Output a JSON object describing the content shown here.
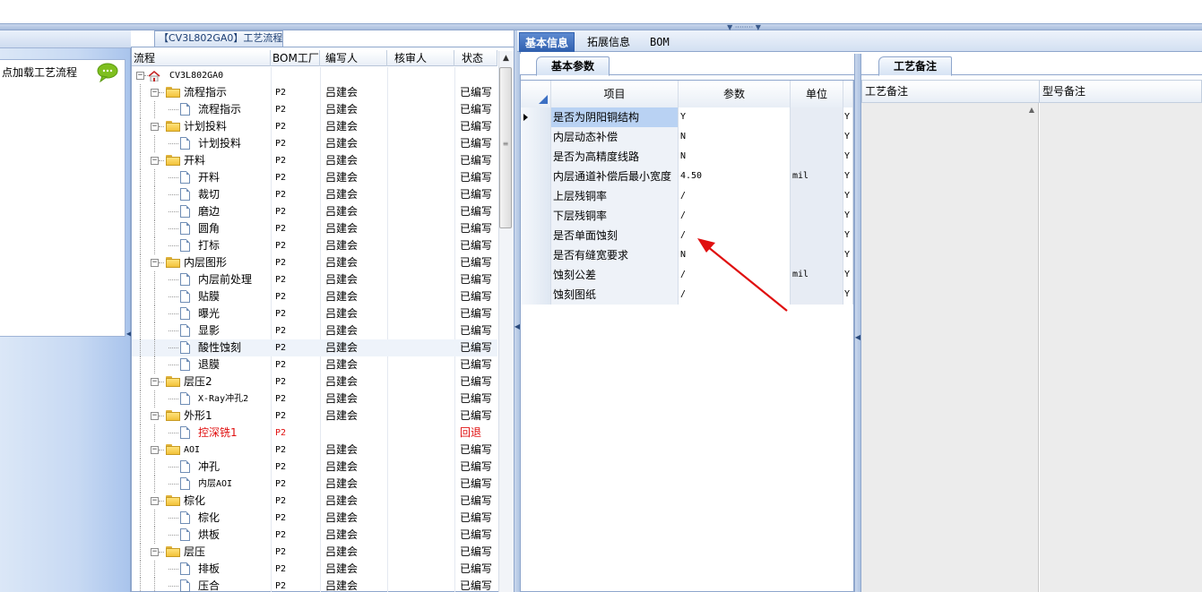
{
  "left": {
    "load_process_text": "点加载工艺流程"
  },
  "center": {
    "caption": "【CV3L802GA0】工艺流程",
    "columns": [
      "流程",
      "BOM工厂",
      "编写人",
      "核审人",
      "状态"
    ],
    "root": "CV3L802GA0",
    "rows": [
      {
        "name": "流程指示",
        "bom": "P2",
        "writer": "吕建会",
        "status": "已编写",
        "level": 1,
        "folder": true
      },
      {
        "name": "流程指示",
        "bom": "P2",
        "writer": "吕建会",
        "status": "已编写",
        "level": 2
      },
      {
        "name": "计划投料",
        "bom": "P2",
        "writer": "吕建会",
        "status": "已编写",
        "level": 1,
        "folder": true
      },
      {
        "name": "计划投料",
        "bom": "P2",
        "writer": "吕建会",
        "status": "已编写",
        "level": 2
      },
      {
        "name": "开料",
        "bom": "P2",
        "writer": "吕建会",
        "status": "已编写",
        "level": 1,
        "folder": true
      },
      {
        "name": "开料",
        "bom": "P2",
        "writer": "吕建会",
        "status": "已编写",
        "level": 2
      },
      {
        "name": "裁切",
        "bom": "P2",
        "writer": "吕建会",
        "status": "已编写",
        "level": 2
      },
      {
        "name": "磨边",
        "bom": "P2",
        "writer": "吕建会",
        "status": "已编写",
        "level": 2
      },
      {
        "name": "圆角",
        "bom": "P2",
        "writer": "吕建会",
        "status": "已编写",
        "level": 2
      },
      {
        "name": "打标",
        "bom": "P2",
        "writer": "吕建会",
        "status": "已编写",
        "level": 2
      },
      {
        "name": "内层图形",
        "bom": "P2",
        "writer": "吕建会",
        "status": "已编写",
        "level": 1,
        "folder": true
      },
      {
        "name": "内层前处理",
        "bom": "P2",
        "writer": "吕建会",
        "status": "已编写",
        "level": 2
      },
      {
        "name": "贴膜",
        "bom": "P2",
        "writer": "吕建会",
        "status": "已编写",
        "level": 2
      },
      {
        "name": "曝光",
        "bom": "P2",
        "writer": "吕建会",
        "status": "已编写",
        "level": 2
      },
      {
        "name": "显影",
        "bom": "P2",
        "writer": "吕建会",
        "status": "已编写",
        "level": 2
      },
      {
        "name": "酸性蚀刻",
        "bom": "P2",
        "writer": "吕建会",
        "status": "已编写",
        "level": 2,
        "selected": true
      },
      {
        "name": "退膜",
        "bom": "P2",
        "writer": "吕建会",
        "status": "已编写",
        "level": 2
      },
      {
        "name": "层压2",
        "bom": "P2",
        "writer": "吕建会",
        "status": "已编写",
        "level": 1,
        "folder": true
      },
      {
        "name": "X-Ray冲孔2",
        "bom": "P2",
        "writer": "吕建会",
        "status": "已编写",
        "level": 2
      },
      {
        "name": "外形1",
        "bom": "P2",
        "writer": "吕建会",
        "status": "已编写",
        "level": 1,
        "folder": true
      },
      {
        "name": "控深铣1",
        "bom": "P2",
        "writer": "",
        "status": "回退",
        "level": 2,
        "red": true
      },
      {
        "name": "AOI",
        "bom": "P2",
        "writer": "吕建会",
        "status": "已编写",
        "level": 1,
        "folder": true
      },
      {
        "name": "冲孔",
        "bom": "P2",
        "writer": "吕建会",
        "status": "已编写",
        "level": 2
      },
      {
        "name": "内层AOI",
        "bom": "P2",
        "writer": "吕建会",
        "status": "已编写",
        "level": 2
      },
      {
        "name": "棕化",
        "bom": "P2",
        "writer": "吕建会",
        "status": "已编写",
        "level": 1,
        "folder": true
      },
      {
        "name": "棕化",
        "bom": "P2",
        "writer": "吕建会",
        "status": "已编写",
        "level": 2
      },
      {
        "name": "烘板",
        "bom": "P2",
        "writer": "吕建会",
        "status": "已编写",
        "level": 2
      },
      {
        "name": "层压",
        "bom": "P2",
        "writer": "吕建会",
        "status": "已编写",
        "level": 1,
        "folder": true
      },
      {
        "name": "排板",
        "bom": "P2",
        "writer": "吕建会",
        "status": "已编写",
        "level": 2
      },
      {
        "name": "压合",
        "bom": "P2",
        "writer": "吕建会",
        "status": "已编写",
        "level": 2
      }
    ]
  },
  "right": {
    "tabs": [
      "基本信息",
      "拓展信息",
      "BOM"
    ],
    "subtab": "基本参数",
    "grid_headers": [
      "项目",
      "参数",
      "单位"
    ],
    "params": [
      {
        "item": "是否为阴阳铜结构",
        "value": "Y",
        "unit": "",
        "flag": "Y"
      },
      {
        "item": "内层动态补偿",
        "value": "N",
        "unit": "",
        "flag": "Y"
      },
      {
        "item": "是否为高精度线路",
        "value": "N",
        "unit": "",
        "flag": "Y"
      },
      {
        "item": "内层通道补偿后最小宽度",
        "value": "4.50",
        "unit": "mil",
        "flag": "Y"
      },
      {
        "item": "上层残铜率",
        "value": "/",
        "unit": "",
        "flag": "Y"
      },
      {
        "item": "下层残铜率",
        "value": "/",
        "unit": "",
        "flag": "Y"
      },
      {
        "item": "是否单面蚀刻",
        "value": "/",
        "unit": "",
        "flag": "Y"
      },
      {
        "item": "是否有缝宽要求",
        "value": "N",
        "unit": "",
        "flag": "Y"
      },
      {
        "item": "蚀刻公差",
        "value": "/",
        "unit": "mil",
        "flag": "Y"
      },
      {
        "item": "蚀刻图纸",
        "value": "/",
        "unit": "",
        "flag": "Y"
      }
    ]
  },
  "far_right": {
    "tab": "工艺备注",
    "columns": [
      "工艺备注",
      "型号备注"
    ]
  },
  "colors": {
    "accent": "#2f5fae",
    "annotation_arrow": "#e01010",
    "rollback_text": "#e01010"
  }
}
